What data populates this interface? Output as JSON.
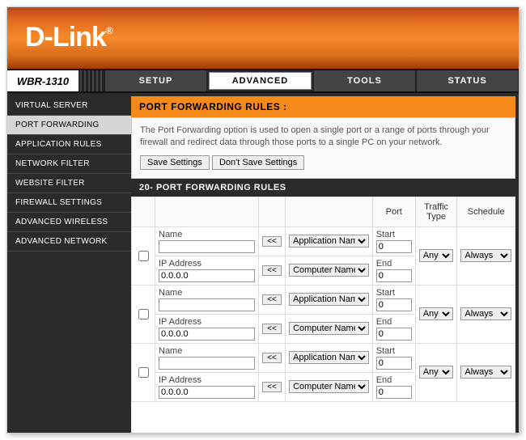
{
  "brand": "D-Link",
  "model": "WBR-1310",
  "tabs": {
    "setup": "SETUP",
    "advanced": "ADVANCED",
    "tools": "TOOLS",
    "status": "STATUS"
  },
  "sidebar": {
    "virtual_server": "VIRTUAL SERVER",
    "port_forwarding": "PORT FORWARDING",
    "application_rules": "APPLICATION RULES",
    "network_filter": "NETWORK FILTER",
    "website_filter": "WEBSITE FILTER",
    "firewall_settings": "FIREWALL SETTINGS",
    "advanced_wireless": "ADVANCED WIRELESS",
    "advanced_network": "ADVANCED NETWORK"
  },
  "header_title": "PORT FORWARDING RULES :",
  "description": "The Port Forwarding option is used to open a single port or a range of ports through your firewall and redirect data through those ports to a single PC on your network.",
  "buttons": {
    "save": "Save Settings",
    "dont_save": "Don't Save Settings",
    "copy": "<<"
  },
  "rules_title": "20- PORT FORWARDING RULES",
  "columns": {
    "port": "Port",
    "traffic": "Traffic Type",
    "schedule": "Schedule"
  },
  "labels": {
    "name": "Name",
    "ip": "IP Address",
    "start": "Start",
    "end": "End"
  },
  "defaults": {
    "app_name": "Application Name",
    "comp_name": "Computer Name",
    "ip": "0.0.0.0",
    "port": "0",
    "traffic": "Any",
    "schedule": "Always"
  },
  "rows": [
    {
      "name": "",
      "ip": "0.0.0.0",
      "start": "0",
      "end": "0"
    },
    {
      "name": "",
      "ip": "0.0.0.0",
      "start": "0",
      "end": "0"
    },
    {
      "name": "",
      "ip": "0.0.0.0",
      "start": "0",
      "end": "0"
    }
  ]
}
